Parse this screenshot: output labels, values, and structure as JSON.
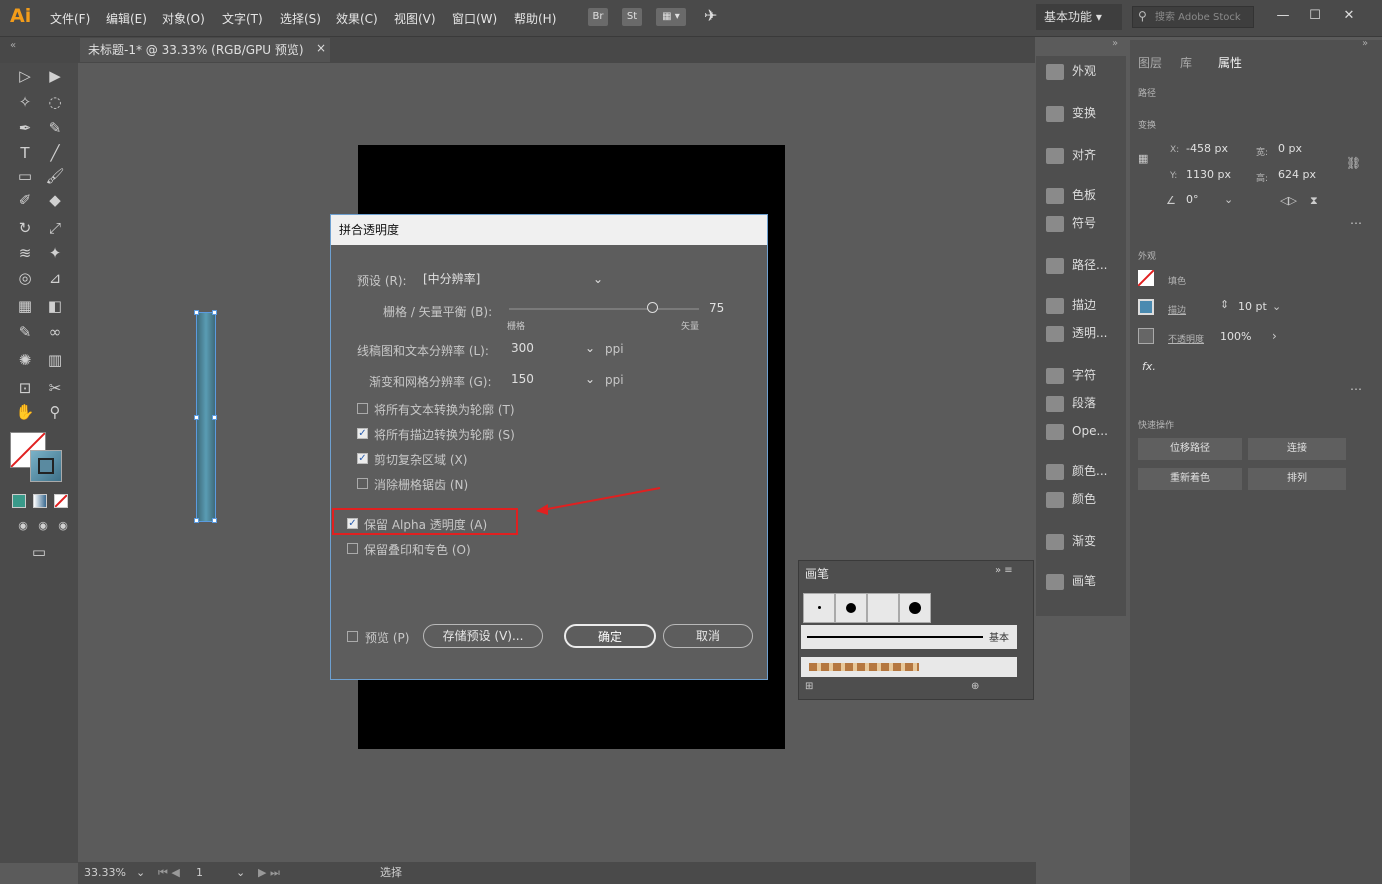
{
  "app": {
    "logo": "Ai"
  },
  "menu": [
    "文件(F)",
    "编辑(E)",
    "对象(O)",
    "文字(T)",
    "选择(S)",
    "效果(C)",
    "视图(V)",
    "窗口(W)",
    "帮助(H)"
  ],
  "toolbar_icons": {
    "bridge": "Br",
    "stock": "St"
  },
  "workspace": {
    "label": "基本功能"
  },
  "search": {
    "placeholder": "搜索 Adobe Stock"
  },
  "document": {
    "tab_title": "未标题-1* @ 33.33% (RGB/GPU 预览)",
    "close": "×"
  },
  "dialog": {
    "title": "拼合透明度",
    "preset_label": "预设 (R):",
    "preset_value": "[中分辨率]",
    "balance_label": "栅格 / 矢量平衡 (B):",
    "balance_value": "75",
    "balance_fraction": 0.75,
    "balance_min_label": "栅格",
    "balance_max_label": "矢量",
    "lineart_label": "线稿图和文本分辨率 (L):",
    "lineart_value": "300",
    "lineart_unit": "ppi",
    "gradient_label": "渐变和网格分辨率 (G):",
    "gradient_value": "150",
    "gradient_unit": "ppi",
    "checkboxes": [
      {
        "label": "将所有文本转换为轮廓 (T)",
        "checked": false
      },
      {
        "label": "将所有描边转换为轮廓 (S)",
        "checked": true
      },
      {
        "label": "剪切复杂区域 (X)",
        "checked": true
      },
      {
        "label": "消除栅格锯齿 (N)",
        "checked": false
      },
      {
        "label": "保留 Alpha 透明度 (A)",
        "checked": true
      },
      {
        "label": "保留叠印和专色 (O)",
        "checked": false
      }
    ],
    "preview_label": "预览 (P)",
    "save_preset_label": "存储预设 (V)...",
    "ok_label": "确定",
    "cancel_label": "取消"
  },
  "icon_panel": [
    "外观",
    "变换",
    "对齐",
    "色板",
    "符号",
    "路径...",
    "描边",
    "透明...",
    "字符",
    "段落",
    "Ope...",
    "颜色...",
    "颜色",
    "渐变",
    "画笔"
  ],
  "properties": {
    "tabs": [
      "图层",
      "库",
      "属性"
    ],
    "section_path": "路径",
    "section_transform": "变换",
    "x_label": "X:",
    "x_value": "-458 px",
    "y_label": "Y:",
    "y_value": "1130 px",
    "w_label": "宽:",
    "w_value": "0 px",
    "h_label": "高:",
    "h_value": "624 px",
    "angle_value": "0°",
    "section_appearance": "外观",
    "fill_label": "填色",
    "stroke_label": "描边",
    "stroke_value": "10 pt",
    "opacity_label": "不透明度",
    "opacity_value": "100%",
    "fx_label": "fx.",
    "section_quick": "快速操作",
    "quick_buttons": [
      "位移路径",
      "连接",
      "重新着色",
      "排列"
    ]
  },
  "brush_panel": {
    "title": "画笔",
    "basic_label": "基本"
  },
  "status": {
    "zoom": "33.33%",
    "artboard": "1",
    "tool": "选择"
  },
  "colors": {
    "accent": "#6ea0d0",
    "highlight": "#e02020",
    "logo": "#f29c1a"
  }
}
